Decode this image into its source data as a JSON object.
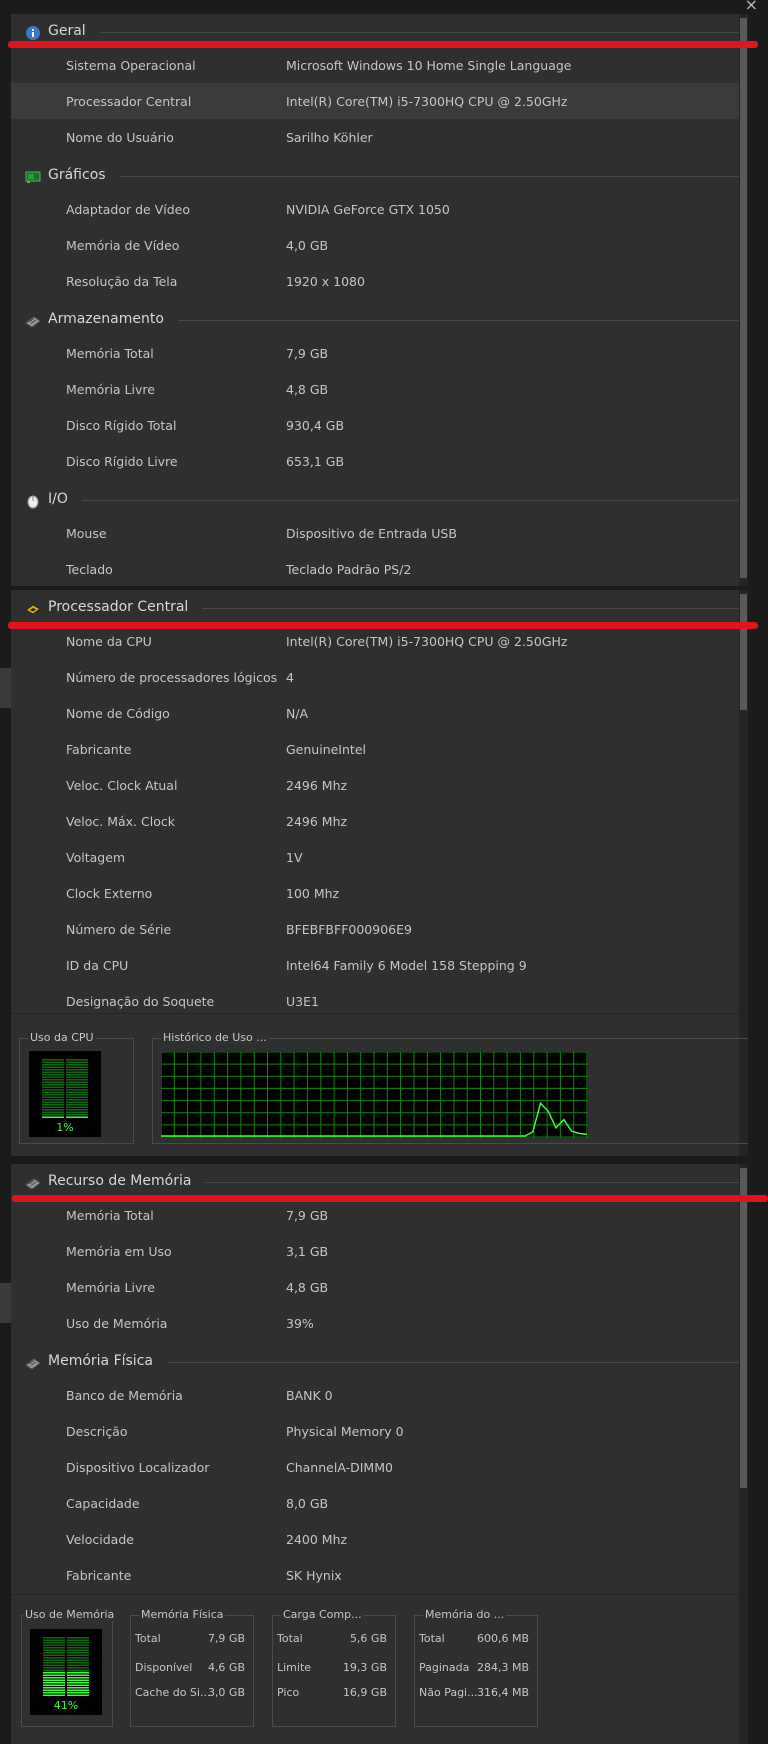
{
  "window": {
    "close_glyph": "×"
  },
  "panel1": {
    "sections": [
      {
        "title": "Geral",
        "icon": "info-icon",
        "rows": [
          {
            "label": "Sistema Operacional",
            "value": "Microsoft Windows 10 Home Single Language"
          },
          {
            "label": "Processador Central",
            "value": "Intel(R) Core(TM) i5-7300HQ CPU @ 2.50GHz"
          },
          {
            "label": "Nome do Usuário",
            "value": "Sarilho Köhler"
          }
        ]
      },
      {
        "title": "Gráficos",
        "icon": "graphics-card-icon",
        "rows": [
          {
            "label": "Adaptador de Vídeo",
            "value": "NVIDIA GeForce GTX 1050"
          },
          {
            "label": "Memória de Vídeo",
            "value": "4,0 GB"
          },
          {
            "label": "Resolução da Tela",
            "value": "1920 x 1080"
          }
        ]
      },
      {
        "title": "Armazenamento",
        "icon": "storage-chip-icon",
        "rows": [
          {
            "label": "Memória Total",
            "value": "7,9 GB"
          },
          {
            "label": "Memória Livre",
            "value": "4,8 GB"
          },
          {
            "label": "Disco Rígido Total",
            "value": "930,4 GB"
          },
          {
            "label": "Disco Rígido Livre",
            "value": "653,1 GB"
          }
        ]
      },
      {
        "title": "I/O",
        "icon": "mouse-icon",
        "rows": [
          {
            "label": "Mouse",
            "value": "Dispositivo de Entrada USB"
          },
          {
            "label": "Teclado",
            "value": "Teclado Padrão PS/2"
          }
        ]
      }
    ]
  },
  "panel2": {
    "sections": [
      {
        "title": "Processador Central",
        "icon": "cpu-chip-icon",
        "rows": [
          {
            "label": "Nome da CPU",
            "value": "Intel(R) Core(TM) i5-7300HQ CPU @ 2.50GHz"
          },
          {
            "label": "Número de processadores lógicos",
            "value": "4"
          },
          {
            "label": "Nome de Código",
            "value": "N/A"
          },
          {
            "label": "Fabricante",
            "value": "GenuineIntel"
          },
          {
            "label": "Veloc. Clock Atual",
            "value": "2496 Mhz"
          },
          {
            "label": "Veloc. Máx. Clock",
            "value": "2496 Mhz"
          },
          {
            "label": "Voltagem",
            "value": "1V"
          },
          {
            "label": "Clock Externo",
            "value": "100 Mhz"
          },
          {
            "label": "Número de Série",
            "value": "BFEBFBFF000906E9"
          },
          {
            "label": "ID da CPU",
            "value": "Intel64 Family 6 Model 158 Stepping 9"
          },
          {
            "label": "Designação do Soquete",
            "value": "U3E1"
          }
        ]
      }
    ],
    "cpu_usage": {
      "title": "Uso da CPU",
      "value_label": "1%",
      "level": 0.01
    },
    "history": {
      "title": "Histórico de Uso ...",
      "usage_samples": [
        0,
        0,
        0,
        0,
        0,
        0,
        0,
        0,
        0,
        0,
        0,
        0,
        0,
        0,
        0,
        0,
        0,
        0,
        0,
        0,
        0,
        0,
        0,
        0,
        0,
        0,
        0,
        0,
        0,
        0,
        0,
        0,
        0,
        0,
        0,
        0,
        0,
        0,
        0,
        0,
        0,
        0,
        0,
        0,
        0,
        0,
        0,
        0,
        5,
        40,
        30,
        10,
        20,
        6,
        3,
        2
      ]
    }
  },
  "panel3": {
    "sections": [
      {
        "title": "Recurso de Memória",
        "icon": "memory-chip-icon",
        "rows": [
          {
            "label": "Memória Total",
            "value": "7,9 GB"
          },
          {
            "label": "Memória em Uso",
            "value": "3,1 GB"
          },
          {
            "label": "Memória Livre",
            "value": "4,8 GB"
          },
          {
            "label": "Uso de Memória",
            "value": "39%"
          }
        ]
      },
      {
        "title": "Memória Física",
        "icon": "ram-chip-icon",
        "rows": [
          {
            "label": "Banco de Memória",
            "value": "BANK 0"
          },
          {
            "label": "Descrição",
            "value": "Physical Memory 0"
          },
          {
            "label": "Dispositivo Localizador",
            "value": "ChannelA-DIMM0"
          },
          {
            "label": "Capacidade",
            "value": "8,0 GB"
          },
          {
            "label": "Velocidade",
            "value": "2400 Mhz"
          },
          {
            "label": "Fabricante",
            "value": "SK Hynix"
          }
        ]
      }
    ],
    "mem_usage": {
      "title": "Uso de Memória",
      "value_label": "41%",
      "level": 0.41
    },
    "groups": [
      {
        "title": "Memória Física",
        "items": [
          {
            "k": "Total",
            "v": "7,9 GB"
          },
          {
            "k": "Disponível",
            "v": "4,6 GB"
          },
          {
            "k": "Cache do Si...",
            "v": "3,0 GB"
          }
        ]
      },
      {
        "title": "Carga Comp...",
        "items": [
          {
            "k": "Total",
            "v": "5,6 GB"
          },
          {
            "k": "Limite",
            "v": "19,3 GB"
          },
          {
            "k": "Pico",
            "v": "16,9 GB"
          }
        ]
      },
      {
        "title": "Memória do ...",
        "items": [
          {
            "k": "Total",
            "v": "600,6 MB"
          },
          {
            "k": "Paginada",
            "v": "284,3 MB"
          },
          {
            "k": "Não Pagi...",
            "v": "316,4 MB"
          }
        ]
      }
    ]
  },
  "colors": {
    "accent_red": "#e0141e",
    "meter_green": "#39ff3a",
    "grid_green": "#0b8a14"
  }
}
